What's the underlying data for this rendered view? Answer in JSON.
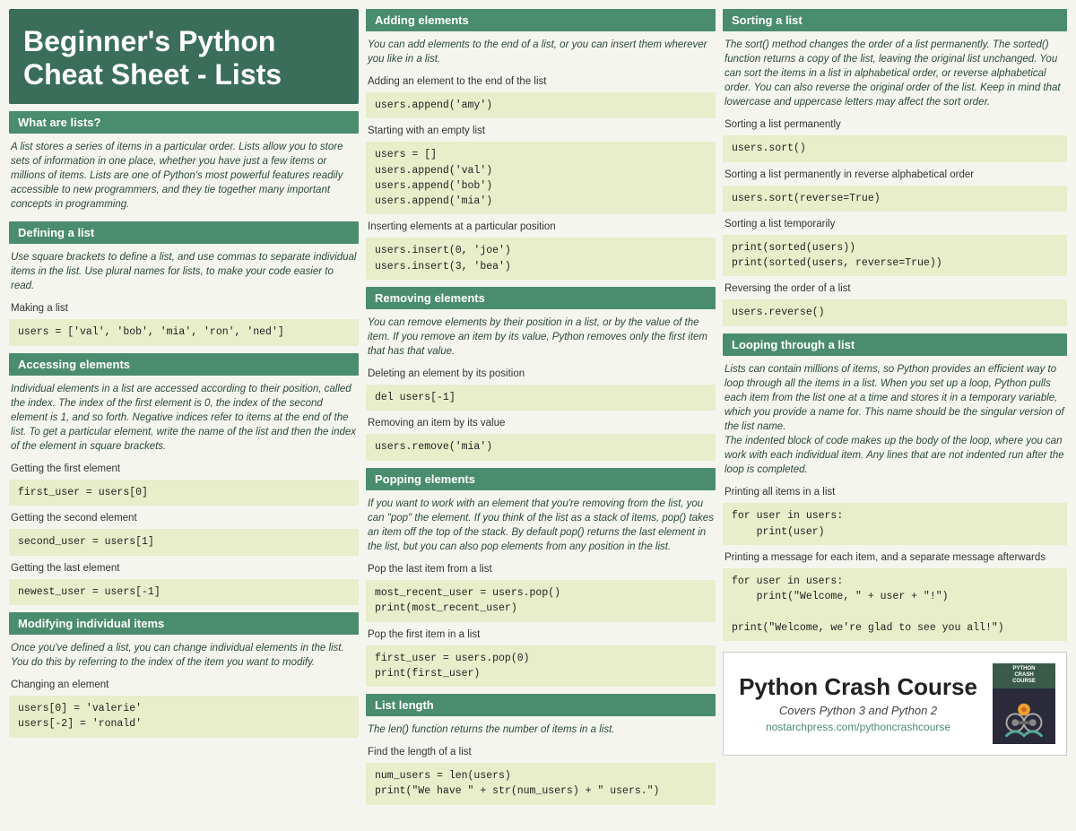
{
  "title": {
    "line1": "Beginner's Python",
    "line2": "Cheat Sheet - Lists"
  },
  "left": {
    "sections": [
      {
        "id": "what-are-lists",
        "header": "What are lists?",
        "desc": "A list stores a series of items in a particular order. Lists allow you to store sets of information in one place, whether you have just a few items or millions of items. Lists are one of Python's most powerful features readily accessible to new programmers, and they tie together many important concepts in programming.",
        "items": []
      },
      {
        "id": "defining-a-list",
        "header": "Defining a list",
        "desc": "Use square brackets to define a list, and use commas to separate individual items in the list. Use plural names for lists, to make your code easier to read.",
        "items": [
          {
            "label": "Making a list",
            "code": "users = ['val', 'bob', 'mia', 'ron', 'ned']"
          }
        ]
      },
      {
        "id": "accessing-elements",
        "header": "Accessing elements",
        "desc": "Individual elements in a list are accessed according to their position, called the index. The index of the first element is 0, the index of the second element is 1, and so forth. Negative indices refer to items at the end of the list. To get a particular element, write the name of the list and then the index of the element in square brackets.",
        "items": [
          {
            "label": "Getting the first element",
            "code": "first_user = users[0]"
          },
          {
            "label": "Getting the second element",
            "code": "second_user = users[1]"
          },
          {
            "label": "Getting the last element",
            "code": "newest_user = users[-1]"
          }
        ]
      },
      {
        "id": "modifying-individual-items",
        "header": "Modifying individual items",
        "desc": "Once you've defined a list, you can change individual elements in the list. You do this by referring to the index of the item you want to modify.",
        "items": [
          {
            "label": "Changing an element",
            "code": "users[0] = 'valerie'\nusers[-2] = 'ronald'"
          }
        ]
      }
    ]
  },
  "mid": {
    "sections": [
      {
        "id": "adding-elements",
        "header": "Adding elements",
        "desc": "You can add elements to the end of a list, or you can insert them wherever you like in a list.",
        "items": [
          {
            "label": "Adding an element to the end of the list",
            "code": "users.append('amy')"
          },
          {
            "label": "Starting with an empty list",
            "code": "users = []\nusers.append('val')\nusers.append('bob')\nusers.append('mia')"
          },
          {
            "label": "Inserting elements at a particular position",
            "code": "users.insert(0, 'joe')\nusers.insert(3, 'bea')"
          }
        ]
      },
      {
        "id": "removing-elements",
        "header": "Removing elements",
        "desc": "You can remove elements by their position in a list, or by the value of the item. If you remove an item by its value, Python removes only the first item that has that value.",
        "items": [
          {
            "label": "Deleting an element by its position",
            "code": "del users[-1]"
          },
          {
            "label": "Removing an item by its value",
            "code": "users.remove('mia')"
          }
        ]
      },
      {
        "id": "popping-elements",
        "header": "Popping elements",
        "desc": "If you want to work with an element that you're removing from the list, you can \"pop\" the element. If you think of the list as a stack of items, pop() takes an item off the top of the stack. By default pop() returns the last element in the list, but you can also pop elements from any position in the list.",
        "items": [
          {
            "label": "Pop the last item from a list",
            "code": "most_recent_user = users.pop()\nprint(most_recent_user)"
          },
          {
            "label": "Pop the first item in a list",
            "code": "first_user = users.pop(0)\nprint(first_user)"
          }
        ]
      },
      {
        "id": "list-length",
        "header": "List length",
        "desc": "The len() function returns the number of items in a list.",
        "items": [
          {
            "label": "Find the length of a list",
            "code": "num_users = len(users)\nprint(\"We have \" + str(num_users) + \" users.\")"
          }
        ]
      }
    ]
  },
  "right": {
    "sections": [
      {
        "id": "sorting-a-list",
        "header": "Sorting a list",
        "desc": "The sort() method changes the order of a list permanently. The sorted() function returns a copy of the list, leaving the original list unchanged. You can sort the items in a list in alphabetical order, or reverse alphabetical order. You can also reverse the original order of the list. Keep in mind that lowercase and uppercase letters may affect the sort order.",
        "items": [
          {
            "label": "Sorting a list permanently",
            "code": "users.sort()"
          },
          {
            "label": "Sorting a list permanently in reverse alphabetical order",
            "code": "users.sort(reverse=True)"
          },
          {
            "label": "Sorting a list temporarily",
            "code": "print(sorted(users))\nprint(sorted(users, reverse=True))"
          },
          {
            "label": "Reversing the order of a list",
            "code": "users.reverse()"
          }
        ]
      },
      {
        "id": "looping-through-a-list",
        "header": "Looping through a list",
        "desc": "Lists can contain millions of items, so Python provides an efficient way to loop through all the items in a list. When you set up a loop, Python pulls each item from the list one at a time and stores it in a temporary variable, which you provide a name for. This name should be the singular version of the list name.\n    The indented block of code makes up the body of the loop, where you can work with each individual item. Any lines that are not indented run after the loop is completed.",
        "items": [
          {
            "label": "Printing all items in a list",
            "code": "for user in users:\n    print(user)"
          },
          {
            "label": "Printing a message for each item, and a separate message afterwards",
            "code": "for user in users:\n    print(\"Welcome, \" + user + \"!\")\n\nprint(\"Welcome, we're glad to see you all!\")"
          }
        ]
      }
    ],
    "book": {
      "title": "Python Crash Course",
      "subtitle": "Covers Python 3 and Python 2",
      "link": "nostarchpress.com/pythoncrashcourse",
      "cover_top": "PYTHON\nCRASH\nCOURSE"
    }
  }
}
